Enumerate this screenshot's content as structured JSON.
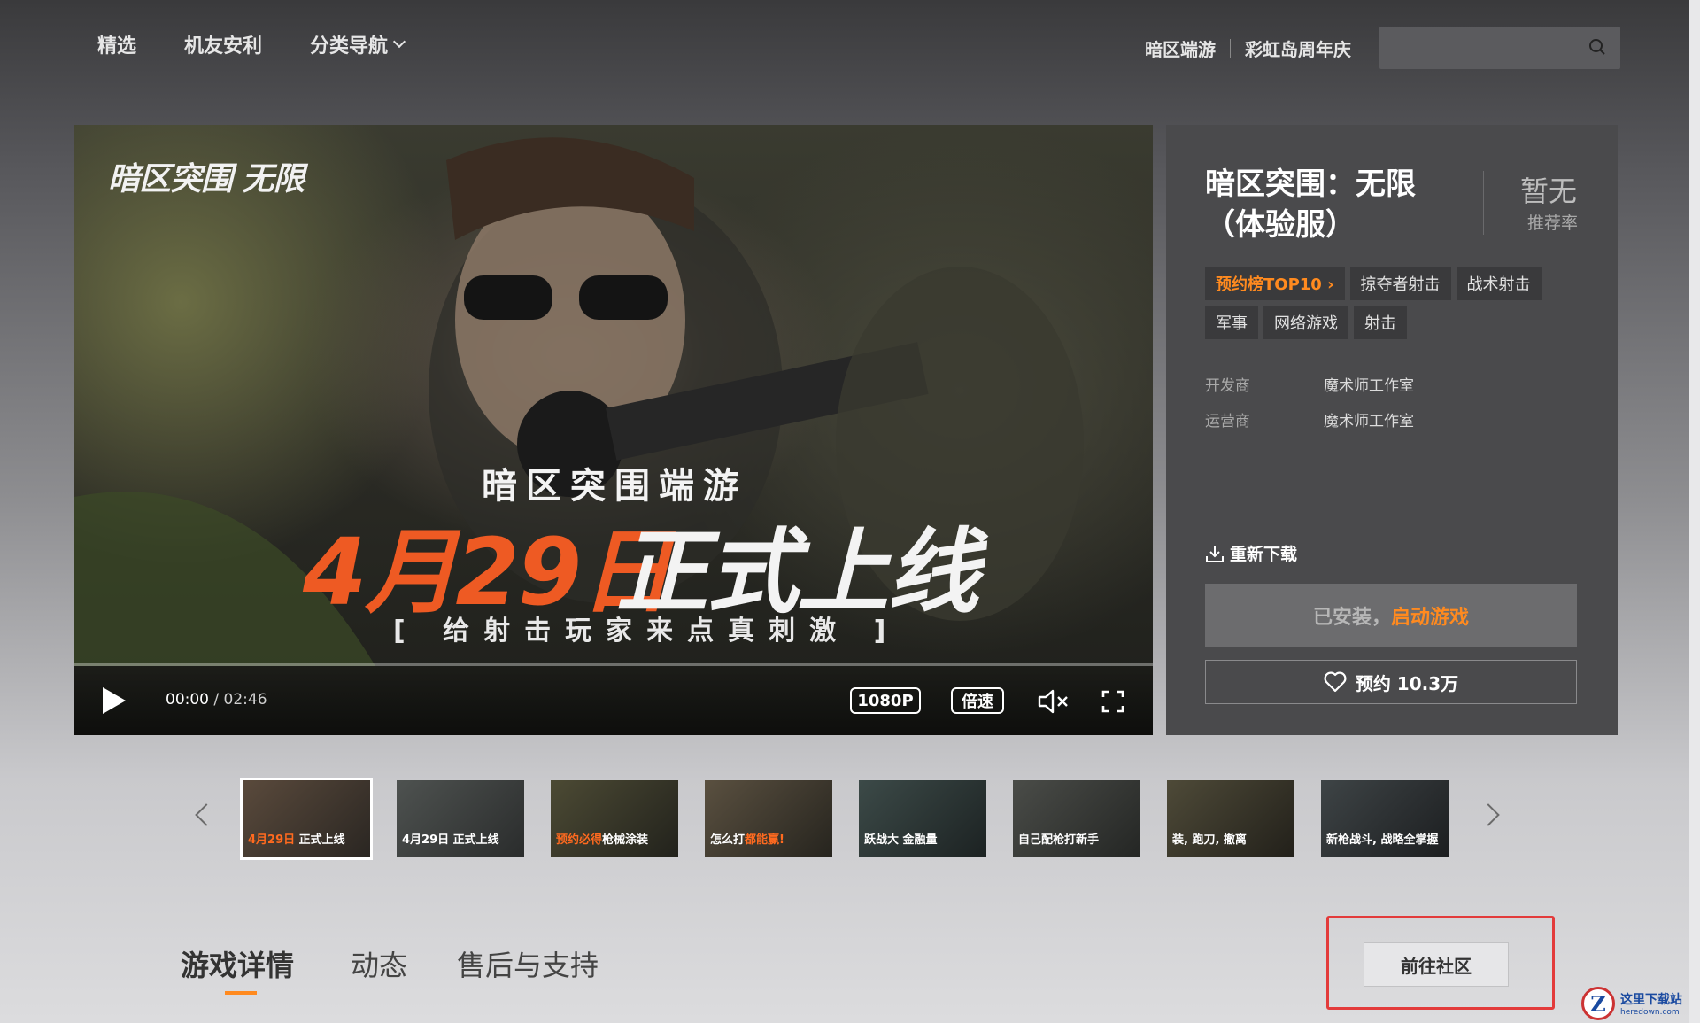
{
  "nav": {
    "items": [
      "精选",
      "机友安利",
      "分类导航"
    ],
    "right_links": [
      "暗区端游",
      "彩虹岛周年庆"
    ],
    "search_placeholder": ""
  },
  "video": {
    "logo_text": "暗区突围 无限",
    "subtitle": "暗区突围端游",
    "date_text": "4月29日",
    "launch_text": "正式上线",
    "tagline": "[ 给射击玩家来点真刺激 ]",
    "current_time": "00:00",
    "separator": " / ",
    "duration": "02:46",
    "quality": "1080P",
    "speed": "倍速"
  },
  "game": {
    "title_line1": "暗区突围：无限",
    "title_line2": "（体验服）",
    "rating_value": "暂无",
    "rating_label": "推荐率",
    "tags": [
      "预约榜TOP10 ›",
      "掠夺者射击",
      "战术射击",
      "军事",
      "网络游戏",
      "射击"
    ],
    "developer_label": "开发商",
    "developer": "魔术师工作室",
    "publisher_label": "运营商",
    "publisher": "魔术师工作室",
    "redownload": "重新下载",
    "installed_text": "已安装，",
    "launch_text": "启动游戏",
    "reserve_text": "预约 10.3万"
  },
  "thumbnails": [
    {
      "caption_a": "4月29日",
      "caption_b": " 正式上线"
    },
    {
      "caption_a": "",
      "caption_b": "4月29日 正式上线"
    },
    {
      "caption_a": "预约必得",
      "caption_b": "枪械涂装"
    },
    {
      "caption_a": "怎么打",
      "caption_b": "都能赢!"
    },
    {
      "caption_a": "",
      "caption_b": "跃战大 金融量"
    },
    {
      "caption_a": "",
      "caption_b": "自己配枪打新手"
    },
    {
      "caption_a": "",
      "caption_b": "装, 跑刀, 撤离"
    },
    {
      "caption_a": "",
      "caption_b": "新枪战斗, 战略全掌握"
    }
  ],
  "tabs": [
    "游戏详情",
    "动态",
    "售后与支持"
  ],
  "community_button": "前往社区",
  "watermark": {
    "logo": "Z",
    "name": "这里下载站",
    "url": "heredown.com"
  },
  "colors": {
    "accent": "#ff8a1f",
    "highlight": "#e33b3b",
    "panel": "#4a4a4c"
  }
}
